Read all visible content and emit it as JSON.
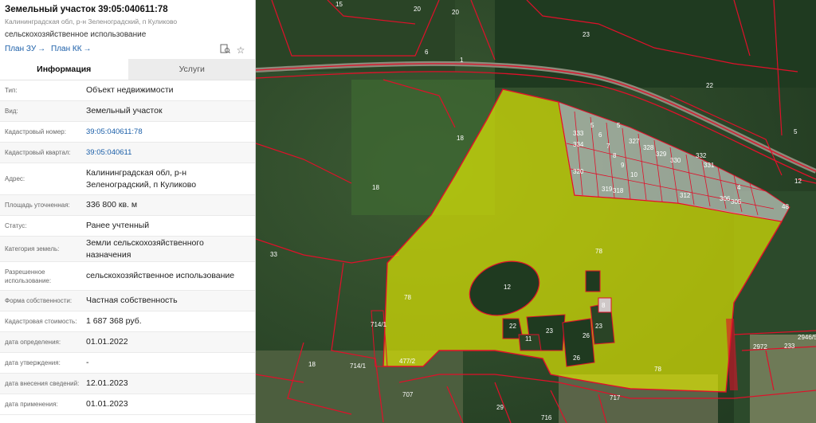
{
  "header": {
    "title": "Земельный участок 39:05:040611:78",
    "address": "Калининградская обл, р-н Зеленоградский, п Куликово",
    "use": "сельскохозяйственное использование",
    "plan_zu": "План ЗУ",
    "plan_kk": "План КК",
    "arrow": "→"
  },
  "tabs": [
    {
      "label": "Информация",
      "active": true
    },
    {
      "label": "Услуги",
      "active": false
    }
  ],
  "rows": [
    {
      "label": "Тип:",
      "value": "Объект недвижимости",
      "link": false
    },
    {
      "label": "Вид:",
      "value": "Земельный участок",
      "link": false
    },
    {
      "label": "Кадастровый номер:",
      "value": "39:05:040611:78",
      "link": true
    },
    {
      "label": "Кадастровый квартал:",
      "value": "39:05:040611",
      "link": true
    },
    {
      "label": "Адрес:",
      "value": "Калининградская обл, р-н Зеленоградский, п Куликово",
      "link": false
    },
    {
      "label": "Площадь уточненная:",
      "value": "336 800 кв. м",
      "link": false
    },
    {
      "label": "Статус:",
      "value": "Ранее учтенный",
      "link": false
    },
    {
      "label": "Категория земель:",
      "value": "Земли сельскохозяйственного назначения",
      "link": false
    },
    {
      "label": "Разрешенное использование:",
      "value": "сельскохозяйственное использование",
      "link": false
    },
    {
      "label": "Форма собственности:",
      "value": "Частная собственность",
      "link": false
    },
    {
      "label": "Кадастровая стоимость:",
      "value": "1 687 368 руб.",
      "link": false
    },
    {
      "label": "дата определения:",
      "value": "01.01.2022",
      "link": false
    },
    {
      "label": "дата утверждения:",
      "value": "-",
      "link": false
    },
    {
      "label": "дата внесения сведений:",
      "value": "12.01.2023",
      "link": false
    },
    {
      "label": "дата применения:",
      "value": "01.01.2023",
      "link": false
    }
  ],
  "icons": {
    "locate": "locate-plan-icon",
    "favorite": "star-icon"
  },
  "colors": {
    "parcel_fill": "#e8f000",
    "boundary": "#e0102a",
    "link": "#1a5ea8"
  },
  "map": {
    "labels": [
      "15",
      "20",
      "20",
      "23",
      "6",
      "1",
      "22",
      "5",
      "5",
      "18",
      "18",
      "33",
      "12",
      "78",
      "78",
      "78",
      "23",
      "8",
      "23",
      "26",
      "26",
      "11",
      "22",
      "714/1",
      "714/1",
      "477/2",
      "18",
      "707",
      "717",
      "716",
      "2972",
      "233",
      "2946/5",
      "29",
      "12",
      "4",
      "5",
      "6",
      "7",
      "8",
      "9",
      "10",
      "331",
      "332",
      "333",
      "334",
      "327",
      "328",
      "329",
      "330",
      "312",
      "320",
      "319",
      "318",
      "306",
      "305",
      "48"
    ]
  }
}
